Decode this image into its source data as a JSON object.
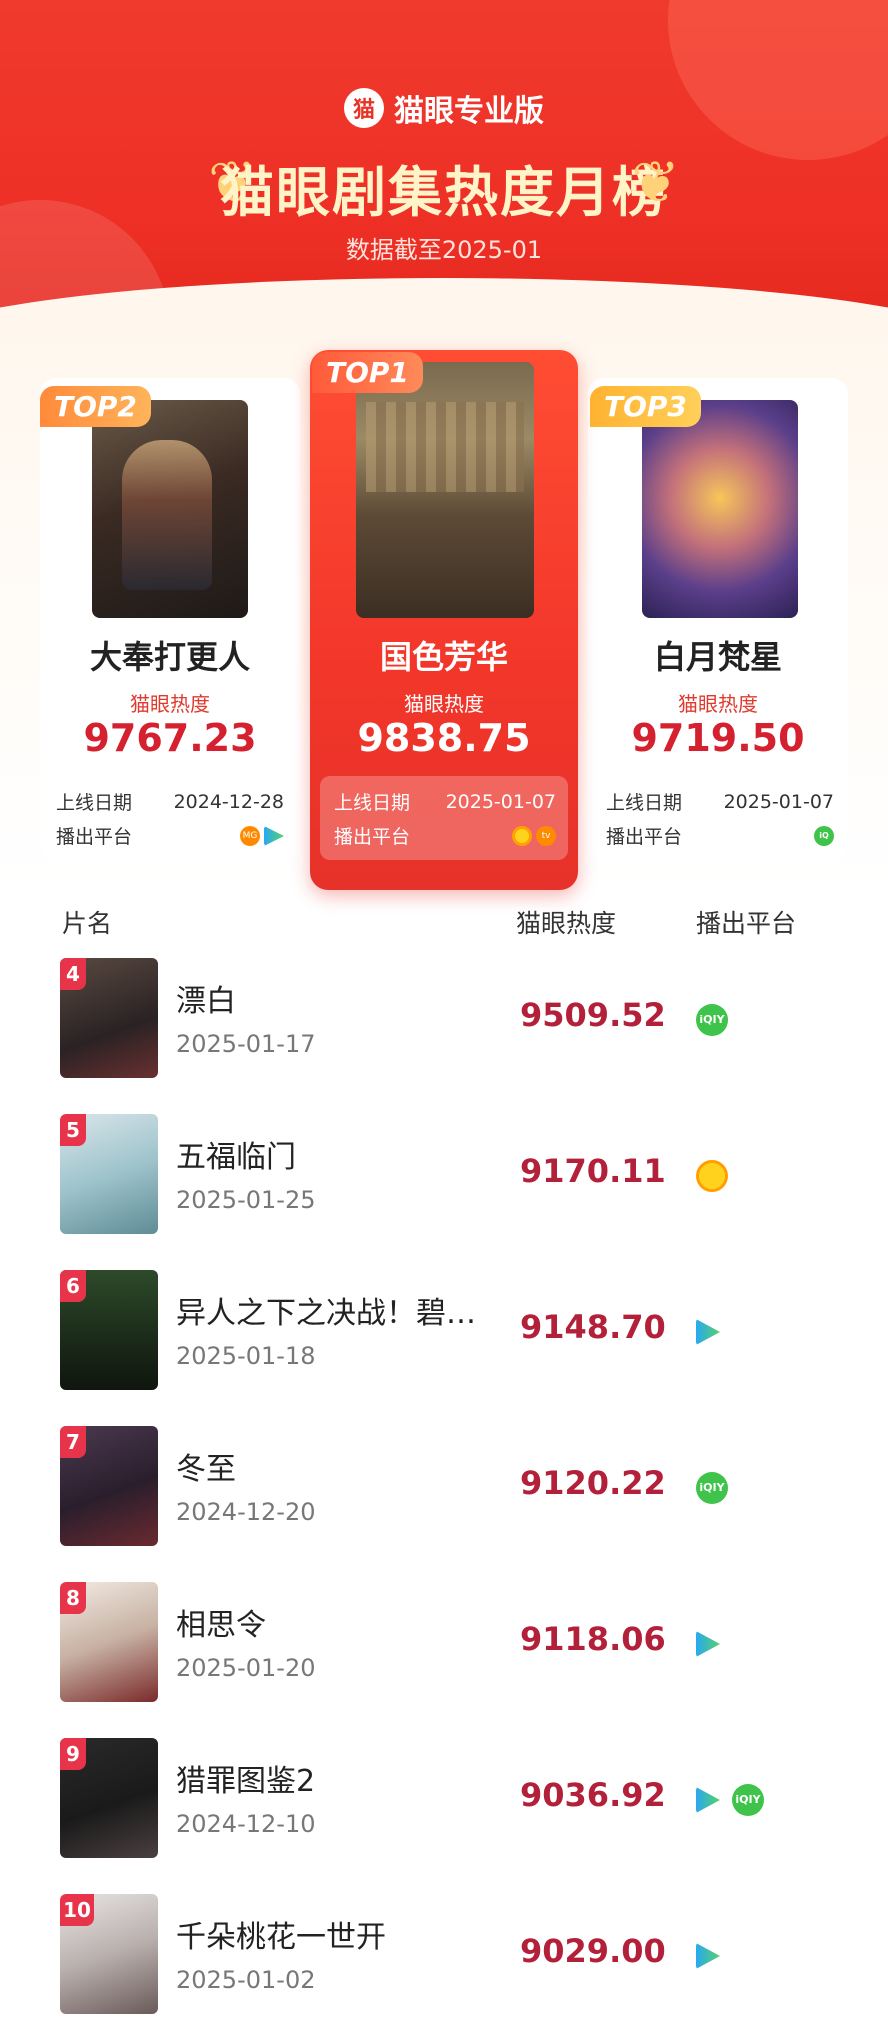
{
  "header": {
    "brand": "猫眼专业版",
    "title": "猫眼剧集热度月榜",
    "subtitle": "数据截至2025-01"
  },
  "top3": {
    "heat_label": "猫眼热度",
    "release_label": "上线日期",
    "platform_label": "播出平台",
    "items": [
      {
        "rank_label": "TOP2",
        "title": "大奉打更人",
        "heat": "9767.23",
        "release_date": "2024-12-28",
        "platforms": [
          "mgtv-icon",
          "tencent-video-icon"
        ]
      },
      {
        "rank_label": "TOP1",
        "title": "国色芳华",
        "heat": "9838.75",
        "release_date": "2025-01-07",
        "platforms": [
          "mango-tv-icon",
          "mgtv-icon"
        ]
      },
      {
        "rank_label": "TOP3",
        "title": "白月梵星",
        "heat": "9719.50",
        "release_date": "2025-01-07",
        "platforms": [
          "iqiyi-icon"
        ]
      }
    ]
  },
  "list": {
    "columns": {
      "name": "片名",
      "heat": "猫眼热度",
      "platform": "播出平台"
    },
    "rows": [
      {
        "rank": "4",
        "title": "漂白",
        "date": "2025-01-17",
        "heat": "9509.52",
        "platforms": [
          "iqiyi"
        ]
      },
      {
        "rank": "5",
        "title": "五福临门",
        "date": "2025-01-25",
        "heat": "9170.11",
        "platforms": [
          "mango"
        ]
      },
      {
        "rank": "6",
        "title": "异人之下之决战！碧…",
        "date": "2025-01-18",
        "heat": "9148.70",
        "platforms": [
          "tencent"
        ]
      },
      {
        "rank": "7",
        "title": "冬至",
        "date": "2024-12-20",
        "heat": "9120.22",
        "platforms": [
          "iqiyi"
        ]
      },
      {
        "rank": "8",
        "title": "相思令",
        "date": "2025-01-20",
        "heat": "9118.06",
        "platforms": [
          "tencent"
        ]
      },
      {
        "rank": "9",
        "title": "猎罪图鉴2",
        "date": "2024-12-10",
        "heat": "9036.92",
        "platforms": [
          "tencent",
          "iqiyi"
        ]
      },
      {
        "rank": "10",
        "title": "千朵桃花一世开",
        "date": "2025-01-02",
        "heat": "9029.00",
        "platforms": [
          "tencent"
        ]
      }
    ]
  },
  "colors": {
    "brand_red": "#ee2f25",
    "heat_red": "#b3203a",
    "rank_badge": "#e8344a",
    "iqiyi_green": "#3fc34a"
  }
}
